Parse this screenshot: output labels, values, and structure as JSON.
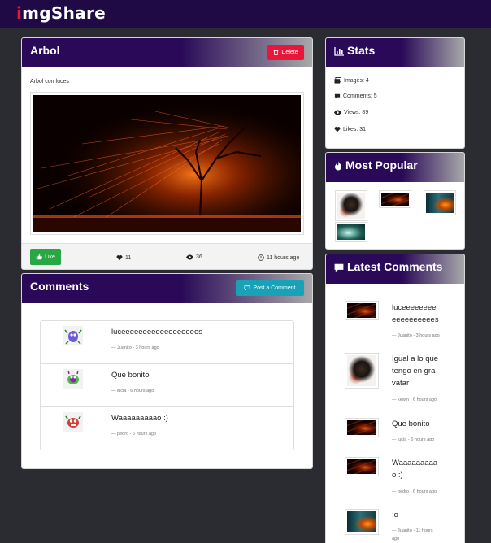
{
  "brand": {
    "prefix": "i",
    "rest": "mgShare"
  },
  "image": {
    "title": "Arbol",
    "delete_label": "Delete",
    "description": "Arbol con luces",
    "like_label": "Like",
    "likes": "11",
    "views": "36",
    "time": "11 hours ago"
  },
  "comments": {
    "title": "Comments",
    "post_label": "Post a Comment",
    "items": [
      {
        "text": "luceeeeeeeeeeeeeeeeees",
        "meta": "— Juanito - 3 hours ago",
        "avatar": "purple-monster"
      },
      {
        "text": "Que bonito",
        "meta": "— lucia - 6 hours ago",
        "avatar": "green-monster"
      },
      {
        "text": "Waaaaaaaaao :)",
        "meta": "— pedro - 6 hours ago",
        "avatar": "red-monster"
      }
    ]
  },
  "stats": {
    "title": "Stats",
    "images": "Images: 4",
    "comments": "Comments: 5",
    "views": "Views: 89",
    "likes": "Likes: 31"
  },
  "popular": {
    "title": "Most Popular"
  },
  "latest": {
    "title": "Latest Comments",
    "items": [
      {
        "text": "luceeeeeeeeeeeeeeeeees",
        "meta": "— Juanito - 3 hours ago"
      },
      {
        "text": "Igual a lo que tengo en gravatar",
        "meta": "— kewin - 6 hours ago"
      },
      {
        "text": "Que bonito",
        "meta": "— lucia - 6 hours ago"
      },
      {
        "text": "Waaaaaaaaao :)",
        "meta": "— pedro - 6 hours ago"
      },
      {
        "text": ":o",
        "meta": "— Juanito - 11 hours ago"
      }
    ]
  },
  "colors": {
    "navbar": "#1f0a45",
    "brand_accent": "#e8173a",
    "delete": "#e8173a",
    "like": "#28a745",
    "post": "#17a2b8"
  }
}
